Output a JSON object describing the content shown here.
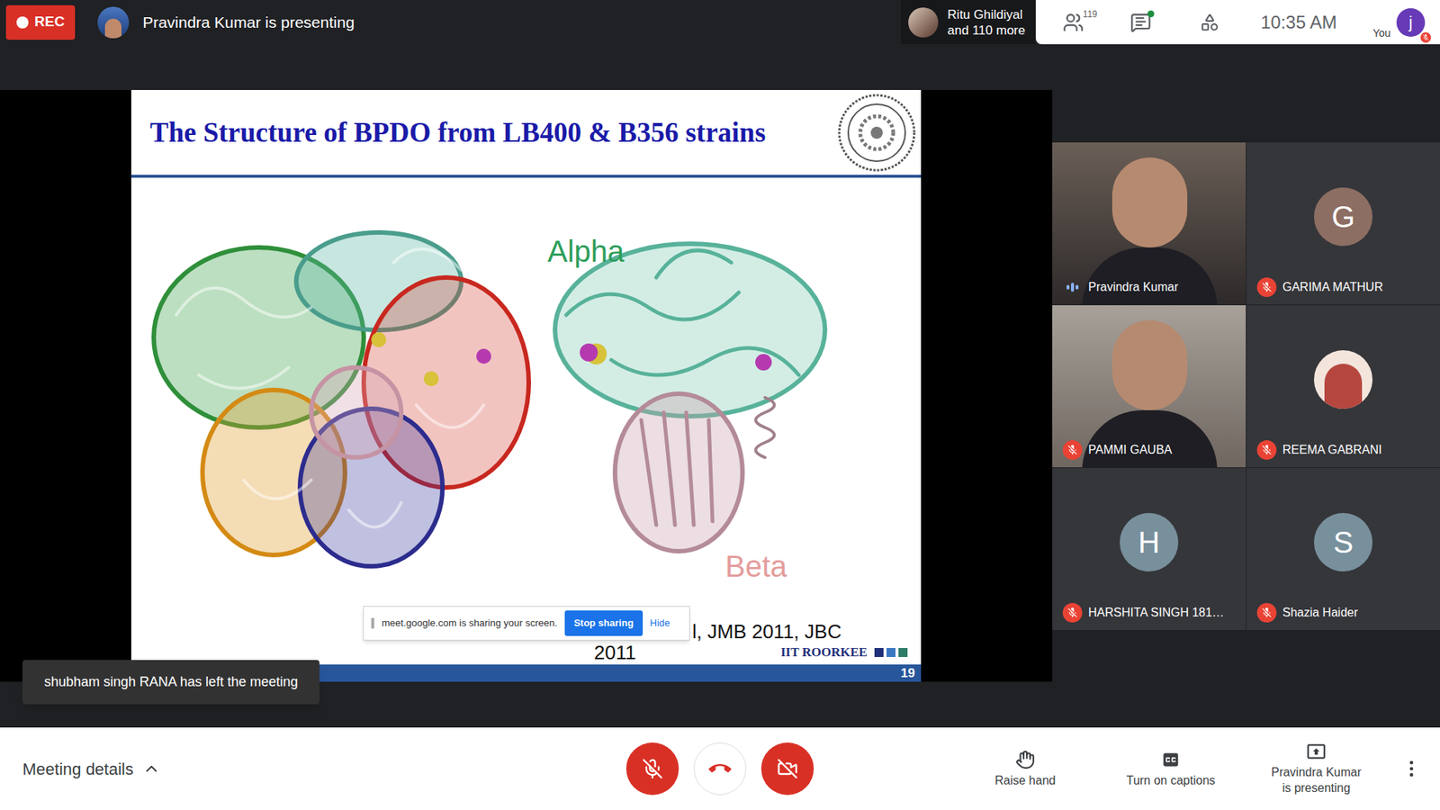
{
  "top_bar": {
    "rec": "REC",
    "presenting": "Pravindra Kumar is presenting",
    "others": {
      "name": "Ritu Ghildiyal",
      "more": "and 110 more"
    },
    "participants_count": "119",
    "chat_unread": true,
    "time": "10:35 AM",
    "you_label": "You",
    "you_initial": "j"
  },
  "slide": {
    "title": "The Structure of BPDO from LB400 & B356 strains",
    "labels": [
      {
        "text": "Alpha",
        "color": "#2e9e5b"
      },
      {
        "text": "Beta",
        "color": "#e49c9c"
      }
    ],
    "citation": [
      "l, JMB 2011, JBC",
      "2011"
    ],
    "footer_brand": "IIT ROORKEE",
    "page": "19"
  },
  "share_bar": {
    "message": "meet.google.com is sharing your screen.",
    "stop": "Stop sharing",
    "hide": "Hide"
  },
  "tiles": [
    {
      "name": "Pravindra Kumar",
      "kind": "video",
      "muted": false,
      "speaking": true
    },
    {
      "name": "GARIMA MATHUR",
      "kind": "letter",
      "initial": "G",
      "color": "#8d6e63",
      "muted": true,
      "speaking": false
    },
    {
      "name": "PAMMI GAUBA",
      "kind": "video",
      "muted": true,
      "speaking": false
    },
    {
      "name": "REEMA GABRANI",
      "kind": "photo",
      "muted": true,
      "speaking": false
    },
    {
      "name": "HARSHITA SINGH 181…",
      "kind": "letter",
      "initial": "H",
      "color": "#78909c",
      "muted": true,
      "speaking": false
    },
    {
      "name": "Shazia Haider",
      "kind": "letter",
      "initial": "S",
      "color": "#78909c",
      "muted": true,
      "speaking": false
    }
  ],
  "toast": "shubham singh RANA has left the meeting",
  "bottom_bar": {
    "meeting_details": "Meeting details",
    "mic_muted": true,
    "camera_off": true,
    "actions": [
      {
        "label": "Raise hand",
        "kind": "hand"
      },
      {
        "label": "Turn on captions",
        "kind": "captions"
      },
      {
        "label": "Pravindra Kumar is presenting",
        "kind": "present"
      }
    ]
  }
}
